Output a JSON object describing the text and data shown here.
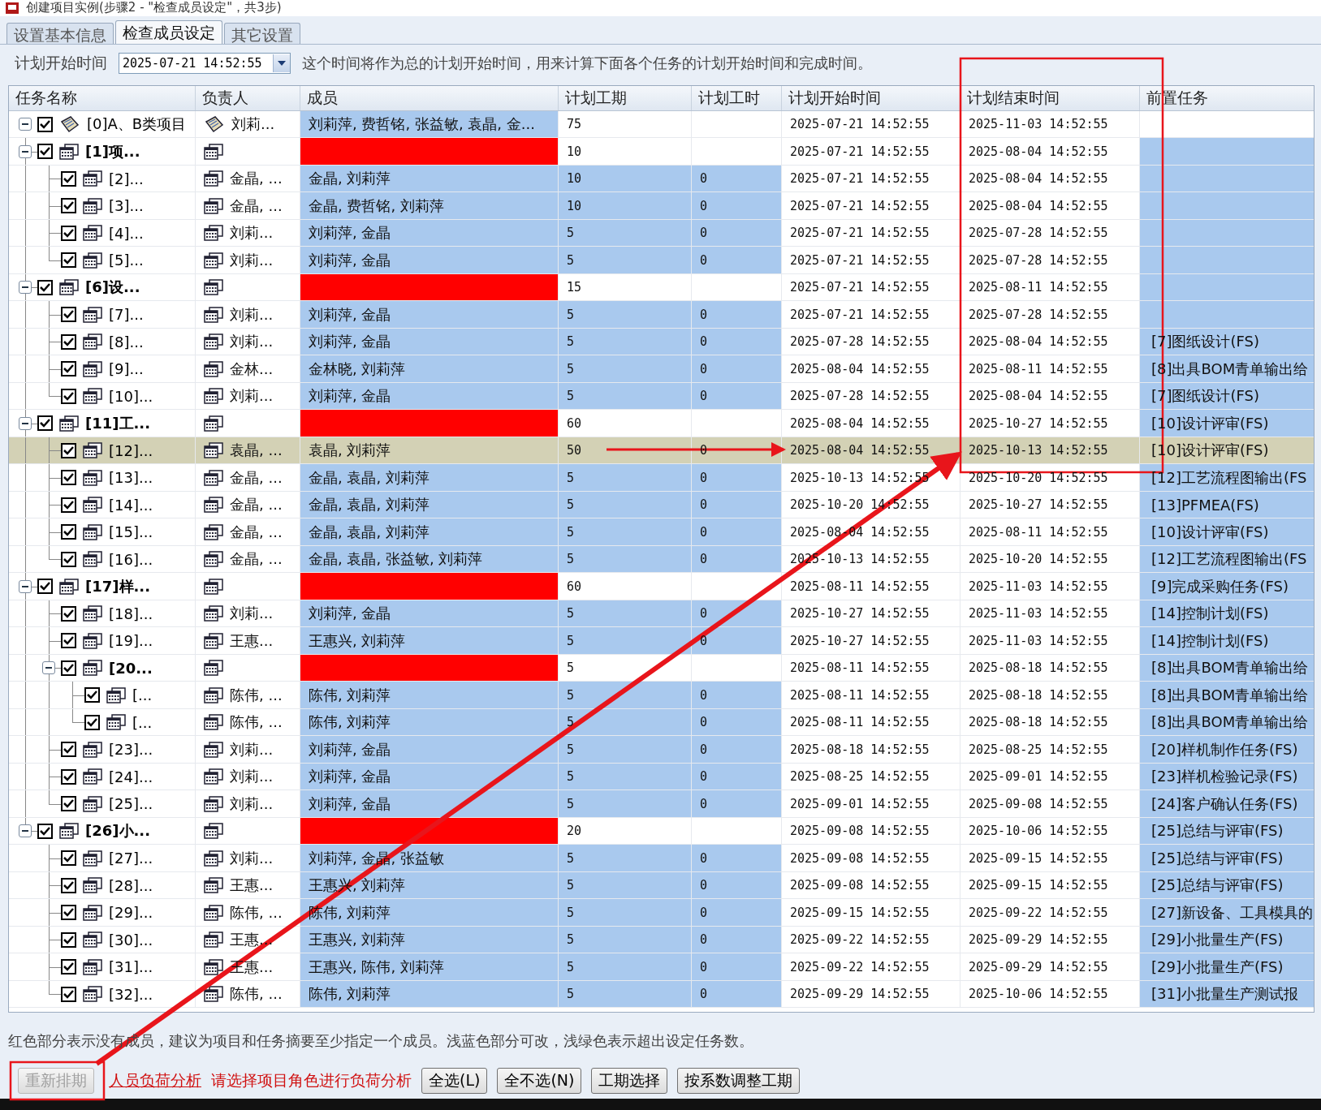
{
  "window": {
    "title": "创建项目实例(步骤2 - \"检查成员设定\"，共3步)"
  },
  "tabs": [
    {
      "label": "设置基本信息",
      "selected": false
    },
    {
      "label": "检查成员设定",
      "selected": true
    },
    {
      "label": "其它设置",
      "selected": false
    }
  ],
  "start_time": {
    "label": "计划开始时间",
    "value": "2025-07-21 14:52:55",
    "hint": "这个时间将作为总的计划开始时间，用来计算下面各个任务的计划开始时间和完成时间。"
  },
  "table": {
    "columns": [
      "任务名称",
      "负责人",
      "成员",
      "计划工期",
      "计划工时",
      "计划开始时间",
      "计划结束时间",
      "前置任务"
    ],
    "rows": [
      {
        "kind": "project",
        "name": "[0]A、B类项目",
        "owner": "刘莉...",
        "members": "刘莉萍, 费哲铭, 张益敏, 袁晶, 金...",
        "duration": "75",
        "start": "2025-07-21 14:52:55",
        "end": "2025-11-03 14:52:55",
        "checked": true,
        "expanded": true,
        "selected": false,
        "children": [
          {
            "kind": "group",
            "name": "[1]项...",
            "duration": "10",
            "start": "2025-07-21 14:52:55",
            "end": "2025-08-04 14:52:55",
            "checked": true,
            "expanded": true,
            "selected": false,
            "children": [
              {
                "kind": "task",
                "name": "[2]...",
                "owner": "金晶, ...",
                "members": "金晶, 刘莉萍",
                "duration": "10",
                "hours": "0",
                "start": "2025-07-21 14:52:55",
                "end": "2025-08-04 14:52:55",
                "checked": true,
                "selected": false
              },
              {
                "kind": "task",
                "name": "[3]...",
                "owner": "金晶, ...",
                "members": "金晶, 费哲铭, 刘莉萍",
                "duration": "10",
                "hours": "0",
                "start": "2025-07-21 14:52:55",
                "end": "2025-08-04 14:52:55",
                "checked": true,
                "selected": false
              },
              {
                "kind": "task",
                "name": "[4]...",
                "owner": "刘莉...",
                "members": "刘莉萍, 金晶",
                "duration": "5",
                "hours": "0",
                "start": "2025-07-21 14:52:55",
                "end": "2025-07-28 14:52:55",
                "checked": true,
                "selected": false
              },
              {
                "kind": "task",
                "name": "[5]...",
                "owner": "刘莉...",
                "members": "刘莉萍, 金晶",
                "duration": "5",
                "hours": "0",
                "start": "2025-07-21 14:52:55",
                "end": "2025-07-28 14:52:55",
                "checked": true,
                "selected": false
              }
            ]
          },
          {
            "kind": "group",
            "name": "[6]设...",
            "duration": "15",
            "start": "2025-07-21 14:52:55",
            "end": "2025-08-11 14:52:55",
            "checked": true,
            "expanded": true,
            "selected": false,
            "children": [
              {
                "kind": "task",
                "name": "[7]...",
                "owner": "刘莉...",
                "members": "刘莉萍, 金晶",
                "duration": "5",
                "hours": "0",
                "start": "2025-07-21 14:52:55",
                "end": "2025-07-28 14:52:55",
                "checked": true,
                "selected": false
              },
              {
                "kind": "task",
                "name": "[8]...",
                "owner": "刘莉...",
                "members": "刘莉萍, 金晶",
                "duration": "5",
                "hours": "0",
                "start": "2025-07-28 14:52:55",
                "end": "2025-08-04 14:52:55",
                "predecessor": "[7]图纸设计(FS)",
                "checked": true,
                "selected": false
              },
              {
                "kind": "task",
                "name": "[9]...",
                "owner": "金林...",
                "members": "金林晓, 刘莉萍",
                "duration": "5",
                "hours": "0",
                "start": "2025-08-04 14:52:55",
                "end": "2025-08-11 14:52:55",
                "predecessor": "[8]出具BOM青单输出给",
                "checked": true,
                "selected": false
              },
              {
                "kind": "task",
                "name": "[10]...",
                "owner": "刘莉...",
                "members": "刘莉萍, 金晶",
                "duration": "5",
                "hours": "0",
                "start": "2025-07-28 14:52:55",
                "end": "2025-08-04 14:52:55",
                "predecessor": "[7]图纸设计(FS)",
                "checked": true,
                "selected": false
              }
            ]
          },
          {
            "kind": "group",
            "name": "[11]工...",
            "duration": "60",
            "start": "2025-08-04 14:52:55",
            "end": "2025-10-27 14:52:55",
            "predecessor": "[10]设计评审(FS)",
            "checked": true,
            "expanded": true,
            "selected": false,
            "children": [
              {
                "kind": "task",
                "name": "[12]...",
                "owner": "袁晶, ...",
                "members": "袁晶, 刘莉萍",
                "duration": "50",
                "hours": "0",
                "start": "2025-08-04 14:52:55",
                "end": "2025-10-13 14:52:55",
                "predecessor": "[10]设计评审(FS)",
                "checked": true,
                "selected": true
              },
              {
                "kind": "task",
                "name": "[13]...",
                "owner": "金晶, ...",
                "members": "金晶, 袁晶, 刘莉萍",
                "duration": "5",
                "hours": "0",
                "start": "2025-10-13 14:52:55",
                "end": "2025-10-20 14:52:55",
                "predecessor": "[12]工艺流程图输出(FS",
                "checked": true,
                "selected": false
              },
              {
                "kind": "task",
                "name": "[14]...",
                "owner": "金晶, ...",
                "members": "金晶, 袁晶, 刘莉萍",
                "duration": "5",
                "hours": "0",
                "start": "2025-10-20 14:52:55",
                "end": "2025-10-27 14:52:55",
                "predecessor": "[13]PFMEA(FS)",
                "checked": true,
                "selected": false
              },
              {
                "kind": "task",
                "name": "[15]...",
                "owner": "金晶, ...",
                "members": "金晶, 袁晶, 刘莉萍",
                "duration": "5",
                "hours": "0",
                "start": "2025-08-04 14:52:55",
                "end": "2025-08-11 14:52:55",
                "predecessor": "[10]设计评审(FS)",
                "checked": true,
                "selected": false
              },
              {
                "kind": "task",
                "name": "[16]...",
                "owner": "金晶, ...",
                "members": "金晶, 袁晶, 张益敏, 刘莉萍",
                "duration": "5",
                "hours": "0",
                "start": "2025-10-13 14:52:55",
                "end": "2025-10-20 14:52:55",
                "predecessor": "[12]工艺流程图输出(FS",
                "checked": true,
                "selected": false
              }
            ]
          },
          {
            "kind": "group",
            "name": "[17]样...",
            "duration": "60",
            "start": "2025-08-11 14:52:55",
            "end": "2025-11-03 14:52:55",
            "predecessor": "[9]完成采购任务(FS)",
            "checked": true,
            "expanded": true,
            "selected": false,
            "children": [
              {
                "kind": "task",
                "name": "[18]...",
                "owner": "刘莉...",
                "members": "刘莉萍, 金晶",
                "duration": "5",
                "hours": "0",
                "start": "2025-10-27 14:52:55",
                "end": "2025-11-03 14:52:55",
                "predecessor": "[14]控制计划(FS)",
                "checked": true,
                "selected": false
              },
              {
                "kind": "task",
                "name": "[19]...",
                "owner": "王惠...",
                "members": "王惠兴, 刘莉萍",
                "duration": "5",
                "hours": "0",
                "start": "2025-10-27 14:52:55",
                "end": "2025-11-03 14:52:55",
                "predecessor": "[14]控制计划(FS)",
                "checked": true,
                "selected": false
              },
              {
                "kind": "group",
                "name": "[20...",
                "duration": "5",
                "start": "2025-08-11 14:52:55",
                "end": "2025-08-18 14:52:55",
                "predecessor": "[8]出具BOM青单输出给",
                "checked": true,
                "expanded": true,
                "selected": false,
                "children": [
                  {
                    "kind": "task",
                    "name": "[...",
                    "owner": "陈伟, ...",
                    "members": "陈伟, 刘莉萍",
                    "duration": "5",
                    "hours": "0",
                    "start": "2025-08-11 14:52:55",
                    "end": "2025-08-18 14:52:55",
                    "predecessor": "[8]出具BOM青单输出给",
                    "checked": true,
                    "selected": false
                  },
                  {
                    "kind": "task",
                    "name": "[...",
                    "owner": "陈伟, ...",
                    "members": "陈伟, 刘莉萍",
                    "duration": "5",
                    "hours": "0",
                    "start": "2025-08-11 14:52:55",
                    "end": "2025-08-18 14:52:55",
                    "predecessor": "[8]出具BOM青单输出给",
                    "checked": true,
                    "selected": false
                  }
                ]
              },
              {
                "kind": "task",
                "name": "[23]...",
                "owner": "刘莉...",
                "members": "刘莉萍, 金晶",
                "duration": "5",
                "hours": "0",
                "start": "2025-08-18 14:52:55",
                "end": "2025-08-25 14:52:55",
                "predecessor": "[20]样机制作任务(FS)",
                "checked": true,
                "selected": false
              },
              {
                "kind": "task",
                "name": "[24]...",
                "owner": "刘莉...",
                "members": "刘莉萍, 金晶",
                "duration": "5",
                "hours": "0",
                "start": "2025-08-25 14:52:55",
                "end": "2025-09-01 14:52:55",
                "predecessor": "[23]样机检验记录(FS)",
                "checked": true,
                "selected": false
              },
              {
                "kind": "task",
                "name": "[25]...",
                "owner": "刘莉...",
                "members": "刘莉萍, 金晶",
                "duration": "5",
                "hours": "0",
                "start": "2025-09-01 14:52:55",
                "end": "2025-09-08 14:52:55",
                "predecessor": "[24]客户确认任务(FS)",
                "checked": true,
                "selected": false
              }
            ]
          },
          {
            "kind": "group",
            "name": "[26]小...",
            "duration": "20",
            "start": "2025-09-08 14:52:55",
            "end": "2025-10-06 14:52:55",
            "predecessor": "[25]总结与评审(FS)",
            "checked": true,
            "expanded": true,
            "selected": false,
            "children": [
              {
                "kind": "task",
                "name": "[27]...",
                "owner": "刘莉...",
                "members": "刘莉萍, 金晶, 张益敏",
                "duration": "5",
                "hours": "0",
                "start": "2025-09-08 14:52:55",
                "end": "2025-09-15 14:52:55",
                "predecessor": "[25]总结与评审(FS)",
                "checked": true,
                "selected": false
              },
              {
                "kind": "task",
                "name": "[28]...",
                "owner": "王惠...",
                "members": "王惠兴, 刘莉萍",
                "duration": "5",
                "hours": "0",
                "start": "2025-09-08 14:52:55",
                "end": "2025-09-15 14:52:55",
                "predecessor": "[25]总结与评审(FS)",
                "checked": true,
                "selected": false
              },
              {
                "kind": "task",
                "name": "[29]...",
                "owner": "陈伟, ...",
                "members": "陈伟, 刘莉萍",
                "duration": "5",
                "hours": "0",
                "start": "2025-09-15 14:52:55",
                "end": "2025-09-22 14:52:55",
                "predecessor": "[27]新设备、工具模具的",
                "checked": true,
                "selected": false
              },
              {
                "kind": "task",
                "name": "[30]...",
                "owner": "王惠...",
                "members": "王惠兴, 刘莉萍",
                "duration": "5",
                "hours": "0",
                "start": "2025-09-22 14:52:55",
                "end": "2025-09-29 14:52:55",
                "predecessor": "[29]小批量生产(FS)",
                "checked": true,
                "selected": false
              },
              {
                "kind": "task",
                "name": "[31]...",
                "owner": "王惠...",
                "members": "王惠兴, 陈伟, 刘莉萍",
                "duration": "5",
                "hours": "0",
                "start": "2025-09-22 14:52:55",
                "end": "2025-09-29 14:52:55",
                "predecessor": "[29]小批量生产(FS)",
                "checked": true,
                "selected": false
              },
              {
                "kind": "task",
                "name": "[32]...",
                "owner": "陈伟, ...",
                "members": "陈伟, 刘莉萍",
                "duration": "5",
                "hours": "0",
                "start": "2025-09-29 14:52:55",
                "end": "2025-10-06 14:52:55",
                "predecessor": "[31]小批量生产测试报",
                "checked": true,
                "selected": false
              }
            ]
          }
        ]
      }
    ]
  },
  "legend": "红色部分表示没有成员，建议为项目和任务摘要至少指定一个成员。浅蓝色部分可改，浅绿色表示超出设定任务数。",
  "footer": [
    {
      "kind": "button",
      "label": "重新排期",
      "disabled": true
    },
    {
      "kind": "link",
      "label": "人员负荷分析"
    },
    {
      "kind": "note",
      "label": "请选择项目角色进行负荷分析"
    },
    {
      "kind": "button",
      "label": "全选(L)",
      "disabled": false
    },
    {
      "kind": "button",
      "label": "全不选(N)",
      "disabled": false
    },
    {
      "kind": "button",
      "label": "工期选择",
      "disabled": false
    },
    {
      "kind": "button",
      "label": "按系数调整工期",
      "disabled": false
    }
  ],
  "annotations": [
    {
      "kind": "frame"
    },
    {
      "kind": "arrow"
    },
    {
      "kind": "arrow"
    },
    {
      "kind": "frame"
    }
  ]
}
